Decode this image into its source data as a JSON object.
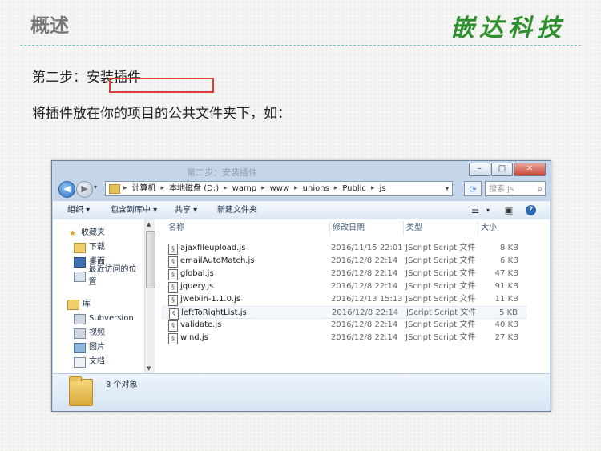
{
  "slide": {
    "title": "概述",
    "brand": "嵌达科技",
    "step": "第二步：安装插件",
    "description": "将插件放在你的项目的公共文件夹下，如："
  },
  "window": {
    "blurred_title": "第二步：安装插件",
    "controls": [
      "–",
      "□",
      "✕"
    ],
    "address": {
      "crumbs": [
        "计算机",
        "本地磁盘 (D:)",
        "wamp",
        "www",
        "unions",
        "Public",
        "js"
      ],
      "search_placeholder": "搜索 js"
    },
    "toolbar": {
      "organize": "组织 ▾",
      "include_library": "包含到库中 ▾",
      "share": "共享 ▾",
      "new_folder": "新建文件夹"
    },
    "nav": {
      "favorites_header": "收藏夹",
      "favorites": [
        "下载",
        "桌面",
        "最近访问的位置"
      ],
      "libraries_header": "库",
      "libraries": [
        "Subversion",
        "视频",
        "图片",
        "文档"
      ]
    },
    "columns": {
      "name": "名称",
      "date": "修改日期",
      "type": "类型",
      "size": "大小"
    },
    "files": [
      {
        "name": "ajaxfileupload.js",
        "date": "2016/11/15 22:01",
        "type": "JScript Script 文件",
        "size": "8 KB"
      },
      {
        "name": "emailAutoMatch.js",
        "date": "2016/12/8 22:14",
        "type": "JScript Script 文件",
        "size": "6 KB"
      },
      {
        "name": "global.js",
        "date": "2016/12/8 22:14",
        "type": "JScript Script 文件",
        "size": "47 KB"
      },
      {
        "name": "jquery.js",
        "date": "2016/12/8 22:14",
        "type": "JScript Script 文件",
        "size": "91 KB"
      },
      {
        "name": "jweixin-1.1.0.js",
        "date": "2016/12/13 15:13",
        "type": "JScript Script 文件",
        "size": "11 KB"
      },
      {
        "name": "leftToRightList.js",
        "date": "2016/12/8 22:14",
        "type": "JScript Script 文件",
        "size": "5 KB"
      },
      {
        "name": "validate.js",
        "date": "2016/12/8 22:14",
        "type": "JScript Script 文件",
        "size": "40 KB"
      },
      {
        "name": "wind.js",
        "date": "2016/12/8 22:14",
        "type": "JScript Script 文件",
        "size": "27 KB"
      }
    ],
    "status": "8 个对象"
  }
}
